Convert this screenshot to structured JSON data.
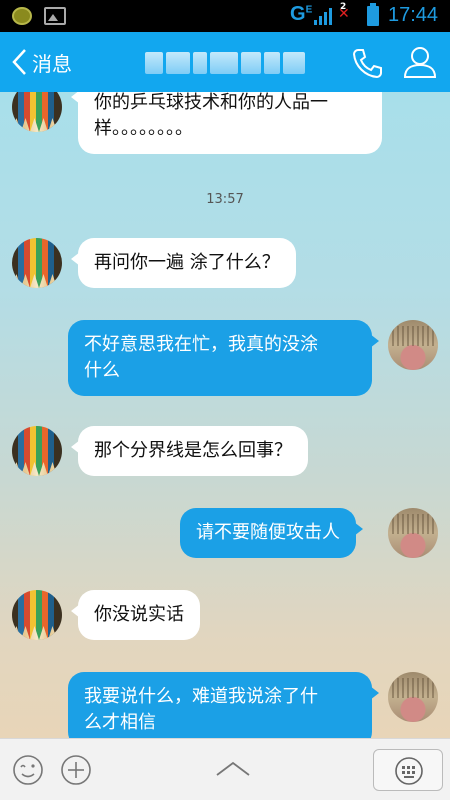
{
  "status_bar": {
    "network": "G",
    "network_sup": "E",
    "sim": "2",
    "time": "17:44",
    "accent_color": "#1e9be0"
  },
  "header": {
    "back_label": "消息",
    "background_color": "#12a7ef"
  },
  "chat": {
    "messages": [
      {
        "side": "in",
        "text_line1": "你的乒乓球技术和你的人品一",
        "text_line2": "样。。。。。。。。"
      },
      {
        "timestamp": "13:57"
      },
      {
        "side": "in",
        "text": "再问你一遍  涂了什么？"
      },
      {
        "side": "out",
        "text_line1": "不好意思我在忙，我真的没涂",
        "text_line2": "什么"
      },
      {
        "side": "in",
        "text": "那个分界线是怎么回事？"
      },
      {
        "side": "out",
        "text": "请不要随便攻击人"
      },
      {
        "side": "in",
        "text": "你没说实话"
      },
      {
        "side": "out",
        "text_line1": "我要说什么，难道我说涂了什",
        "text_line2": "么才相信"
      }
    ],
    "incoming_bubble_color": "#ffffff",
    "outgoing_bubble_color": "#1ba0e6"
  },
  "bottom_bar": {
    "icons": [
      "emoji-icon",
      "plus-icon",
      "chevron-up-icon",
      "keyboard-icon"
    ]
  }
}
